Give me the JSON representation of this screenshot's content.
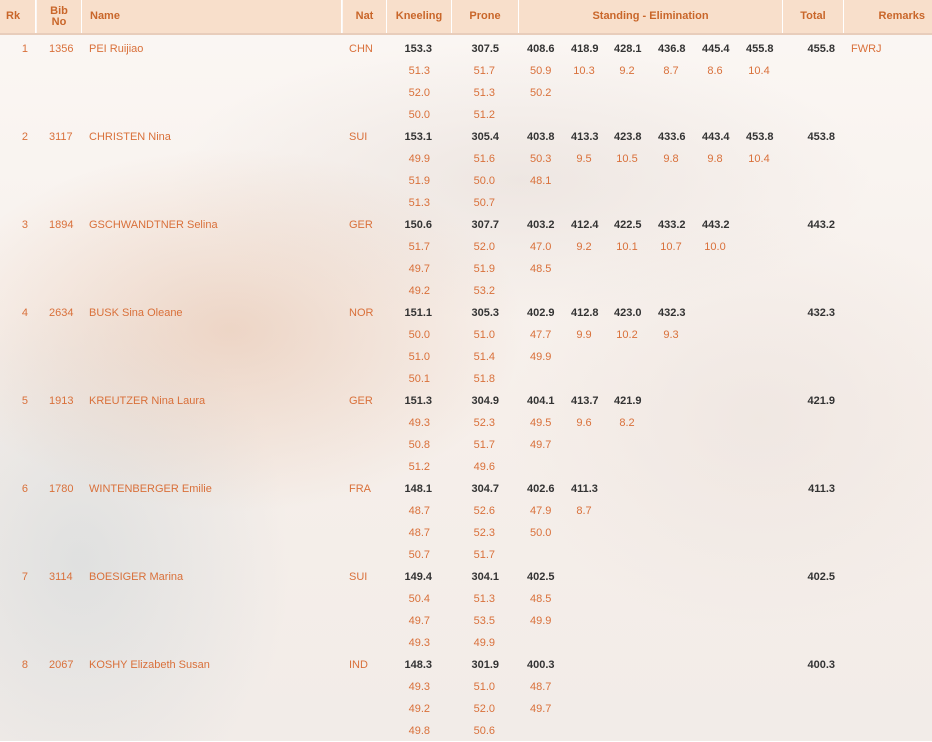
{
  "header": {
    "rank": "Rk",
    "bib": "Bib\nNo",
    "name": "Name",
    "nat": "Nat",
    "kneeling": "Kneeling",
    "prone": "Prone",
    "standing": "Standing - Elimination",
    "total": "Total",
    "remarks": "Remarks"
  },
  "athletes": [
    {
      "rank": "1",
      "bib": "1356",
      "name": "PEI Ruijiao",
      "nat": "CHN",
      "kneeling": "153.3",
      "kneeling_series": [
        "51.3",
        "52.0",
        "50.0"
      ],
      "prone": "307.5",
      "prone_series": [
        "51.7",
        "51.3",
        "51.2"
      ],
      "standing_totals": [
        "408.6",
        "418.9",
        "428.1",
        "436.8",
        "445.4",
        "455.8"
      ],
      "standing_series": [
        "50.9",
        "10.3",
        "9.2",
        "8.7",
        "8.6",
        "10.4"
      ],
      "standing_series2": "50.2",
      "total": "455.8",
      "remarks": "FWRJ"
    },
    {
      "rank": "2",
      "bib": "3117",
      "name": "CHRISTEN Nina",
      "nat": "SUI",
      "kneeling": "153.1",
      "kneeling_series": [
        "49.9",
        "51.9",
        "51.3"
      ],
      "prone": "305.4",
      "prone_series": [
        "51.6",
        "50.0",
        "50.7"
      ],
      "standing_totals": [
        "403.8",
        "413.3",
        "423.8",
        "433.6",
        "443.4",
        "453.8"
      ],
      "standing_series": [
        "50.3",
        "9.5",
        "10.5",
        "9.8",
        "9.8",
        "10.4"
      ],
      "standing_series2": "48.1",
      "total": "453.8",
      "remarks": ""
    },
    {
      "rank": "3",
      "bib": "1894",
      "name": "GSCHWANDTNER Selina",
      "nat": "GER",
      "kneeling": "150.6",
      "kneeling_series": [
        "51.7",
        "49.7",
        "49.2"
      ],
      "prone": "307.7",
      "prone_series": [
        "52.0",
        "51.9",
        "53.2"
      ],
      "standing_totals": [
        "403.2",
        "412.4",
        "422.5",
        "433.2",
        "443.2"
      ],
      "standing_series": [
        "47.0",
        "9.2",
        "10.1",
        "10.7",
        "10.0"
      ],
      "standing_series2": "48.5",
      "total": "443.2",
      "remarks": ""
    },
    {
      "rank": "4",
      "bib": "2634",
      "name": "BUSK Sina Oleane",
      "nat": "NOR",
      "kneeling": "151.1",
      "kneeling_series": [
        "50.0",
        "51.0",
        "50.1"
      ],
      "prone": "305.3",
      "prone_series": [
        "51.0",
        "51.4",
        "51.8"
      ],
      "standing_totals": [
        "402.9",
        "412.8",
        "423.0",
        "432.3"
      ],
      "standing_series": [
        "47.7",
        "9.9",
        "10.2",
        "9.3"
      ],
      "standing_series2": "49.9",
      "total": "432.3",
      "remarks": ""
    },
    {
      "rank": "5",
      "bib": "1913",
      "name": "KREUTZER Nina Laura",
      "nat": "GER",
      "kneeling": "151.3",
      "kneeling_series": [
        "49.3",
        "50.8",
        "51.2"
      ],
      "prone": "304.9",
      "prone_series": [
        "52.3",
        "51.7",
        "49.6"
      ],
      "standing_totals": [
        "404.1",
        "413.7",
        "421.9"
      ],
      "standing_series": [
        "49.5",
        "9.6",
        "8.2"
      ],
      "standing_series2": "49.7",
      "total": "421.9",
      "remarks": ""
    },
    {
      "rank": "6",
      "bib": "1780",
      "name": "WINTENBERGER Emilie",
      "nat": "FRA",
      "kneeling": "148.1",
      "kneeling_series": [
        "48.7",
        "48.7",
        "50.7"
      ],
      "prone": "304.7",
      "prone_series": [
        "52.6",
        "52.3",
        "51.7"
      ],
      "standing_totals": [
        "402.6",
        "411.3"
      ],
      "standing_series": [
        "47.9",
        "8.7"
      ],
      "standing_series2": "50.0",
      "total": "411.3",
      "remarks": ""
    },
    {
      "rank": "7",
      "bib": "3114",
      "name": "BOESIGER Marina",
      "nat": "SUI",
      "kneeling": "149.4",
      "kneeling_series": [
        "50.4",
        "49.7",
        "49.3"
      ],
      "prone": "304.1",
      "prone_series": [
        "51.3",
        "53.5",
        "49.9"
      ],
      "standing_totals": [
        "402.5"
      ],
      "standing_series": [
        "48.5"
      ],
      "standing_series2": "49.9",
      "total": "402.5",
      "remarks": ""
    },
    {
      "rank": "8",
      "bib": "2067",
      "name": "KOSHY Elizabeth Susan",
      "nat": "IND",
      "kneeling": "148.3",
      "kneeling_series": [
        "49.3",
        "49.2",
        "49.8"
      ],
      "prone": "301.9",
      "prone_series": [
        "51.0",
        "52.0",
        "50.6"
      ],
      "standing_totals": [
        "400.3"
      ],
      "standing_series": [
        "48.7"
      ],
      "standing_series2": "49.7",
      "total": "400.3",
      "remarks": ""
    }
  ]
}
